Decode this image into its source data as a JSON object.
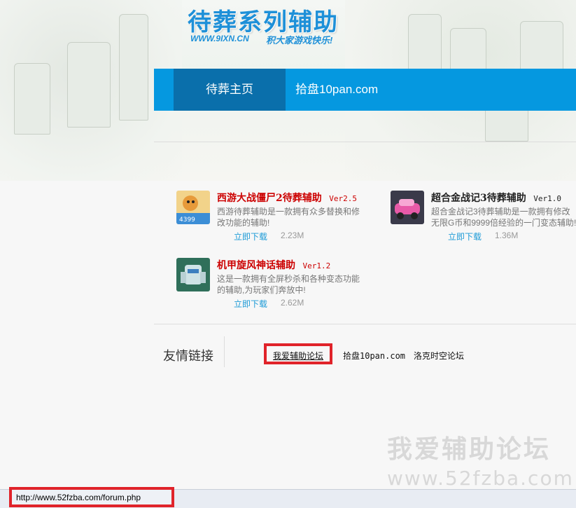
{
  "header": {
    "logo_title": "待葬系列辅助",
    "logo_url": "WWW.9IXN.CN",
    "logo_slogan": "积大家游戏快乐!",
    "nav": [
      {
        "label": "待葬主页",
        "active": true
      },
      {
        "label": "拾盘10pan.com",
        "active": false
      }
    ]
  },
  "games": [
    {
      "title": "西游大战僵尸2待葬辅助",
      "version": "Ver2.5",
      "description": "西游待葬辅助是一款拥有众多替换和修改功能的辅助!",
      "download_label": "立即下载",
      "size": "2.23M",
      "icon": "zombie-game-icon"
    },
    {
      "title": "超合金战记3待葬辅助",
      "version": "Ver1.0",
      "description": "超合金战记3待葬辅助是一款拥有修改无限G币和9999倍经验的一门变态辅助!",
      "download_label": "立即下载",
      "size": "1.36M",
      "icon": "car-game-icon"
    },
    {
      "title": "机甲旋风神话辅助",
      "version": "Ver1.2",
      "description": "这是一款拥有全屏秒杀和各种变态功能的辅助,为玩家们奔放中!",
      "download_label": "立即下载",
      "size": "2.62M",
      "icon": "mech-game-icon"
    }
  ],
  "friend_links": {
    "title": "友情链接",
    "links": [
      "我爱辅助论坛",
      "拾盘10pan.com",
      "洛克时空论坛"
    ]
  },
  "watermark": {
    "line1": "我爱辅助论坛",
    "line2": "www.52fzba.com"
  },
  "statusbar": {
    "url": "http://www.52fzba.com/forum.php"
  },
  "colors": {
    "nav_bg": "#0598e0",
    "nav_active": "#0a6fab",
    "game_title": "#cc0000",
    "download_link": "#1e9bd7",
    "highlight": "#e0232a"
  }
}
